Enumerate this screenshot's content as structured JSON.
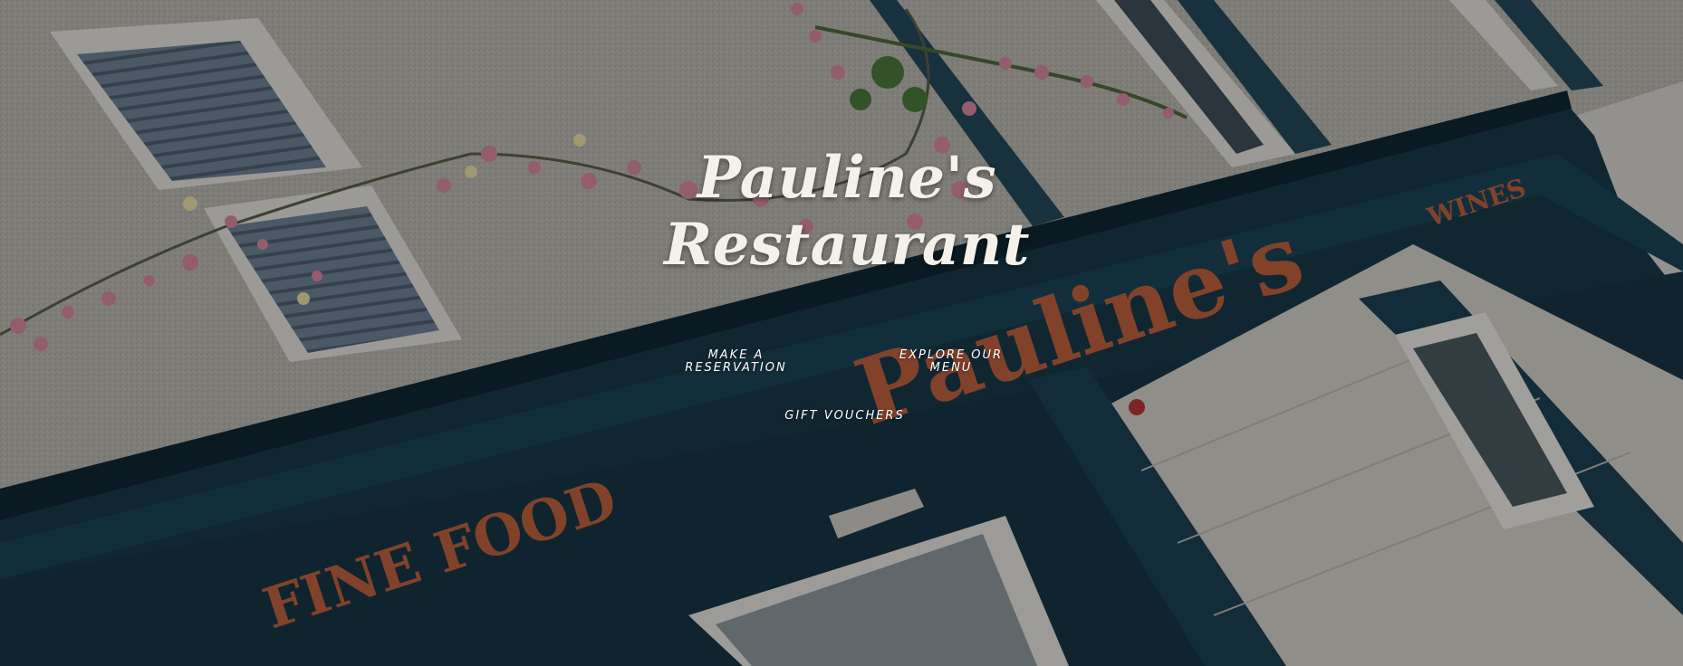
{
  "hero": {
    "title_line1": "Pauline's",
    "title_line2": "Restaurant",
    "background_image": "Photo of restaurant storefront facade with teal signage and pink flowers"
  },
  "sign": {
    "main": "Pauline's",
    "left": "FINE FOOD",
    "right": "WINES"
  },
  "nav": {
    "reservation_line1": "MAKE A",
    "reservation_line2": "RESERVATION",
    "menu_line1": "EXPLORE OUR",
    "menu_line2": "MENU",
    "vouchers": "GIFT VOUCHERS"
  },
  "colors": {
    "fascia_teal": "#183a4a",
    "letter_copper": "#c0623f",
    "wall_render": "#b9b6ad",
    "title_text": "#f4f1ea"
  }
}
